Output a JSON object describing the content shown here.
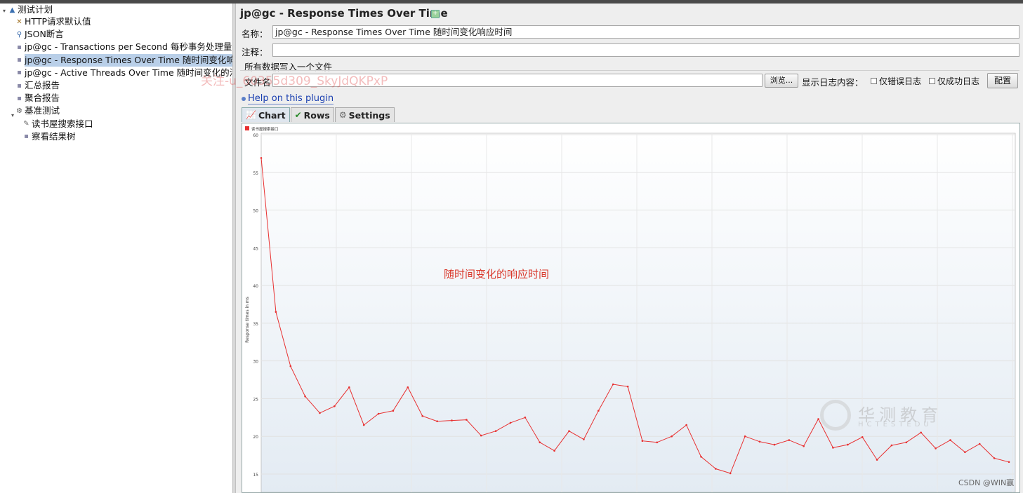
{
  "tree": {
    "items": [
      {
        "label": "测试计划",
        "icon": "test-plan-icon",
        "indent": 1
      },
      {
        "label": "HTTP请求默认值",
        "icon": "wrench-icon",
        "indent": 2
      },
      {
        "label": "JSON断言",
        "icon": "magnifier-icon",
        "indent": 2
      },
      {
        "label": "jp@gc - Transactions per Second 每秒事务处理量",
        "icon": "graph-icon",
        "indent": 2
      },
      {
        "label": "jp@gc - Response Times Over Time 随时间变化响",
        "icon": "graph-icon",
        "indent": 2
      },
      {
        "label": "jp@gc - Active Threads Over Time 随时间变化的活",
        "icon": "graph-icon",
        "indent": 2
      },
      {
        "label": "汇总报告",
        "icon": "graph-icon",
        "indent": 2
      },
      {
        "label": "聚合报告",
        "icon": "graph-icon",
        "indent": 2
      },
      {
        "label": "基准测试",
        "icon": "gear-icon",
        "indent": 2
      },
      {
        "label": "读书屋搜索接口",
        "icon": "pencil-icon",
        "indent": 3
      },
      {
        "label": "察看结果树",
        "icon": "graph-icon",
        "indent": 3
      }
    ],
    "selected_index": 4
  },
  "panel": {
    "title": "jp@gc - Response Times Over Time",
    "name_label": "名称：",
    "name_value": "jp@gc - Response Times Over Time 随时间变化响应时间",
    "comment_label": "注释：",
    "comment_value": "",
    "write_all_label": "所有数据写入一个文件",
    "file_label": "文件名",
    "file_value": "",
    "browse_button": "浏览...",
    "log_content_label": "显示日志内容：",
    "errors_only_label": "仅错误日志",
    "success_only_label": "仅成功日志",
    "configure_button": "配置",
    "help_link": "Help on this plugin",
    "tabs": [
      {
        "label": "Chart",
        "icon": "chart-icon",
        "active": true
      },
      {
        "label": "Rows",
        "icon": "checkmark-icon",
        "active": false
      },
      {
        "label": "Settings",
        "icon": "gear-icon",
        "active": false
      }
    ]
  },
  "watermark": {
    "user": "关注-u_60355d309_SkyJdQKPxP",
    "annotation": "随时间变化的响应时间",
    "logo": "华测教育",
    "logo_sub": "HCTESTEDU",
    "csdn": "CSDN @WIN嬴"
  },
  "chart_data": {
    "type": "line",
    "title": "",
    "xlabel": "",
    "ylabel": "Response times in ms",
    "ylim": [
      14,
      60
    ],
    "yticks": [
      15,
      20,
      25,
      30,
      35,
      40,
      45,
      50,
      55,
      60
    ],
    "grid": true,
    "legend_position": "top-left",
    "series": [
      {
        "name": "读书屋搜索接口",
        "color": "#e83030",
        "values": [
          56.9,
          36.5,
          29.3,
          25.3,
          23.1,
          24.0,
          26.5,
          21.5,
          23.0,
          23.4,
          26.5,
          22.7,
          22.0,
          22.1,
          22.2,
          20.1,
          20.7,
          21.8,
          22.5,
          19.2,
          18.1,
          20.7,
          19.6,
          23.4,
          26.9,
          26.6,
          19.4,
          19.2,
          20.0,
          21.5,
          17.3,
          15.7,
          15.1,
          20.0,
          19.3,
          18.9,
          19.5,
          18.7,
          22.3,
          18.5,
          18.9,
          19.9,
          16.9,
          18.8,
          19.2,
          20.5,
          18.4,
          19.5,
          17.9,
          19.0,
          17.1,
          16.6
        ]
      }
    ]
  }
}
